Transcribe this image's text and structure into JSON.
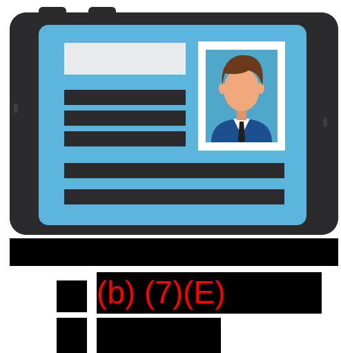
{
  "illustration": {
    "icon": "tablet-id-card-icon",
    "colors": {
      "device_body": "#2b2b2d",
      "screen": "#5bb5dd",
      "photo_frame": "#ffffff",
      "photo_bg": "#4fa7c9",
      "hair": "#6b3a1a",
      "skin": "#f0a87c",
      "suit": "#1d4e8f",
      "shirt": "#ffffff",
      "tie": "#1f1f1f",
      "text_bar": "#2b2b2d",
      "title_bar": "#e8eaeb"
    }
  },
  "redaction": {
    "code_label": "(b) (7)(E)",
    "code_color": "#ff0000",
    "block_color": "#000000"
  }
}
